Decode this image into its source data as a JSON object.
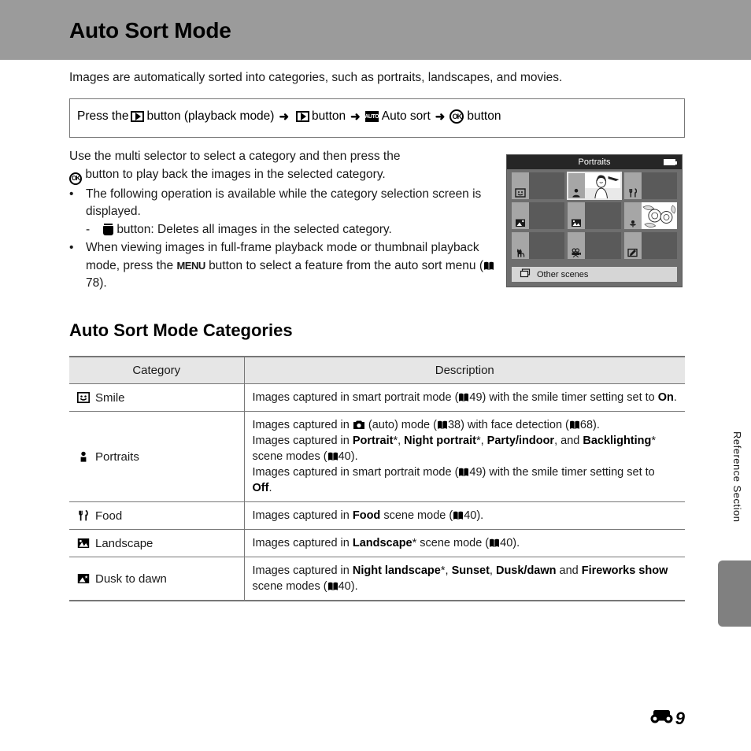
{
  "header": {
    "title": "Auto Sort Mode"
  },
  "intro": "Images are automatically sorted into categories, such as portraits, landscapes, and movies.",
  "steps": {
    "prefix": "Press the",
    "seg1": "button (playback mode)",
    "seg2": "button",
    "auto_label": "Auto sort",
    "seg3": "button",
    "play_icon": "playback-icon",
    "auto_icon": "auto-sort-icon",
    "ok_icon": "ok-button-icon",
    "arrow": "➜",
    "auto_text": "AUTO",
    "ok_text": "OK"
  },
  "body": {
    "line1_a": "Use the multi selector to select a category and then press the",
    "line1_b": "button to play back the images in the selected category.",
    "bullet1": "The following operation is available while the category selection screen is displayed.",
    "sub1_a": "button: Deletes all images in the selected category.",
    "sub1_dash": "-",
    "bullet2_a": "When viewing images in full-frame playback mode or thumbnail playback mode, press the",
    "bullet2_menu": "MENU",
    "bullet2_b": "button to select a feature from the auto sort menu (",
    "bullet2_ref": "78",
    "bullet2_c": ").",
    "bullet_mark": "•"
  },
  "lcd": {
    "title": "Portraits",
    "battery_icon": "battery-icon",
    "bottom_label": "Other scenes",
    "bottom_icon": "other-scenes-icon",
    "cells": [
      {
        "icon": "smile-icon",
        "selected": false,
        "has_thumb": false
      },
      {
        "icon": "portraits-icon",
        "selected": true,
        "has_thumb": true
      },
      {
        "icon": "food-icon",
        "selected": false,
        "has_thumb": false
      },
      {
        "icon": "dusk-to-dawn-icon",
        "selected": false,
        "has_thumb": false
      },
      {
        "icon": "landscape-icon",
        "selected": false,
        "has_thumb": false
      },
      {
        "icon": "close-up-icon",
        "selected": false,
        "has_thumb": true
      },
      {
        "icon": "pet-portrait-icon",
        "selected": false,
        "has_thumb": false
      },
      {
        "icon": "movie-icon",
        "selected": false,
        "has_thumb": false
      },
      {
        "icon": "retouched-icon",
        "selected": false,
        "has_thumb": false
      }
    ]
  },
  "section": {
    "heading": "Auto Sort Mode Categories"
  },
  "table": {
    "columns": [
      "Category",
      "Description"
    ],
    "rows": [
      {
        "icon": "smile-icon",
        "category": "Smile",
        "description_parts": [
          {
            "t": "Images captured in smart portrait mode ("
          },
          {
            "book": true
          },
          {
            "t": "49) with the smile timer setting set to "
          },
          {
            "t": "On",
            "bold": true
          },
          {
            "t": "."
          }
        ]
      },
      {
        "icon": "portraits-icon",
        "category": "Portraits",
        "description_parts": [
          {
            "t": "Images captured in "
          },
          {
            "cam": true
          },
          {
            "t": " (auto) mode ("
          },
          {
            "book": true
          },
          {
            "t": "38) with face detection ("
          },
          {
            "book": true
          },
          {
            "t": "68)."
          },
          {
            "br": true
          },
          {
            "t": "Images captured in "
          },
          {
            "t": "Portrait",
            "bold": true
          },
          {
            "t": "*, "
          },
          {
            "t": "Night portrait",
            "bold": true
          },
          {
            "t": "*, "
          },
          {
            "t": "Party/indoor",
            "bold": true
          },
          {
            "t": ", and "
          },
          {
            "t": "Backlighting",
            "bold": true
          },
          {
            "t": "* scene modes ("
          },
          {
            "book": true
          },
          {
            "t": "40)."
          },
          {
            "br": true
          },
          {
            "t": "Images captured in smart portrait mode ("
          },
          {
            "book": true
          },
          {
            "t": "49) with the smile timer setting set to "
          },
          {
            "t": "Off",
            "bold": true
          },
          {
            "t": "."
          }
        ]
      },
      {
        "icon": "food-icon",
        "category": "Food",
        "description_parts": [
          {
            "t": "Images captured in "
          },
          {
            "t": "Food",
            "bold": true
          },
          {
            "t": " scene mode ("
          },
          {
            "book": true
          },
          {
            "t": "40)."
          }
        ]
      },
      {
        "icon": "landscape-icon",
        "category": "Landscape",
        "description_parts": [
          {
            "t": "Images captured in "
          },
          {
            "t": "Landscape",
            "bold": true
          },
          {
            "t": "* scene mode ("
          },
          {
            "book": true
          },
          {
            "t": "40)."
          }
        ]
      },
      {
        "icon": "dusk-to-dawn-icon",
        "category": "Dusk to dawn",
        "description_parts": [
          {
            "t": "Images captured in "
          },
          {
            "t": "Night landscape",
            "bold": true
          },
          {
            "t": "*, "
          },
          {
            "t": "Sunset",
            "bold": true
          },
          {
            "t": ", "
          },
          {
            "t": "Dusk/dawn",
            "bold": true
          },
          {
            "t": " and "
          },
          {
            "t": "Fireworks show",
            "bold": true
          },
          {
            "t": " scene modes ("
          },
          {
            "book": true
          },
          {
            "t": "40)."
          }
        ]
      }
    ]
  },
  "side": {
    "label": "Reference Section"
  },
  "footer": {
    "page_number": "9",
    "section_icon": "reference-section-icon"
  },
  "colors": {
    "header_band": "#9b9b9b",
    "table_header": "#e6e6e6",
    "rule": "#777777",
    "lcd_bg": "#6e6e6e",
    "side_tab": "#808080"
  }
}
